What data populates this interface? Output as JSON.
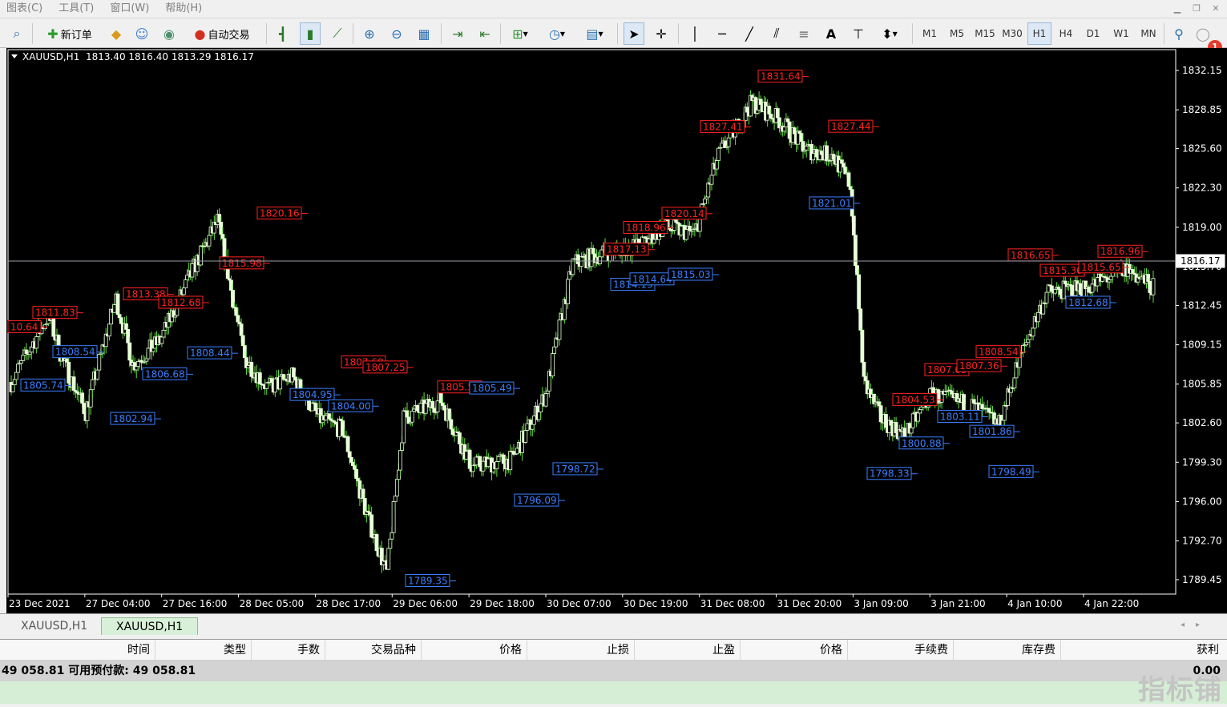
{
  "menu": [
    "图表(C)",
    "工具(T)",
    "窗口(W)",
    "帮助(H)"
  ],
  "toolbar": {
    "new_order": "新订单",
    "auto_trade": "自动交易",
    "font_tool": "A",
    "timeframes": [
      "M1",
      "M5",
      "M15",
      "M30",
      "H1",
      "H4",
      "D1",
      "W1",
      "MN"
    ],
    "active_timeframe": "H1",
    "notification_count": "1"
  },
  "chart": {
    "info": "XAUUSD,H1  1813.40 1816.40 1813.29 1816.17",
    "current_price": "1816.17",
    "y_axis_ticks": [
      "1832.15",
      "1828.85",
      "1825.60",
      "1822.30",
      "1819.00",
      "1815.70",
      "1812.45",
      "1809.15",
      "1805.85",
      "1802.60",
      "1799.30",
      "1796.00",
      "1792.70",
      "1789.45"
    ],
    "x_axis_ticks": [
      "23 Dec 2021",
      "27 Dec 04:00",
      "27 Dec 16:00",
      "28 Dec 05:00",
      "28 Dec 17:00",
      "29 Dec 06:00",
      "29 Dec 18:00",
      "30 Dec 07:00",
      "30 Dec 19:00",
      "31 Dec 08:00",
      "31 Dec 20:00",
      "3 Jan 09:00",
      "3 Jan 21:00",
      "4 Jan 10:00",
      "4 Jan 22:00"
    ],
    "high_labels": [
      "10.64",
      "1811.83",
      "1813.38",
      "1812.68",
      "1815.98",
      "1820.16",
      "1807.68",
      "1807.25",
      "1805.58",
      "1817.13",
      "1818.96",
      "1820.14",
      "1827.41",
      "1831.64",
      "1827.44",
      "1804.53",
      "1807.03",
      "1807.36",
      "1808.54",
      "1816.65",
      "1815.36",
      "1815.65",
      "1816.96"
    ],
    "low_labels": [
      "1805.74",
      "1808.54",
      "1802.94",
      "1806.68",
      "1808.44",
      "1804.95",
      "1804.00",
      "1805.49",
      "1789.35",
      "1796.09",
      "1798.72",
      "1814.19",
      "1814.64",
      "1815.03",
      "1821.01",
      "1798.33",
      "1800.88",
      "1803.11",
      "1801.86",
      "1798.49",
      "1812.68"
    ],
    "colors": {
      "background": "#000000",
      "bull": "#e8ffd8",
      "bear": "#e8ffd8",
      "wick": "#66dd44",
      "high_label": "#ff2222",
      "low_label": "#3a7fff",
      "price_line": "#9aa0a6"
    }
  },
  "tabs": [
    {
      "label": "XAUUSD,H1",
      "active": false
    },
    {
      "label": "XAUUSD,H1",
      "active": true
    }
  ],
  "terminal": {
    "columns": [
      "时间",
      "类型",
      "手数",
      "交易品种",
      "价格",
      "止损",
      "止盈",
      "价格",
      "手续费",
      "库存费",
      "获利"
    ],
    "balance_text": "49 058.81  可用预付款: 49 058.81",
    "profit": "0.00"
  },
  "watermark": "指标铺"
}
